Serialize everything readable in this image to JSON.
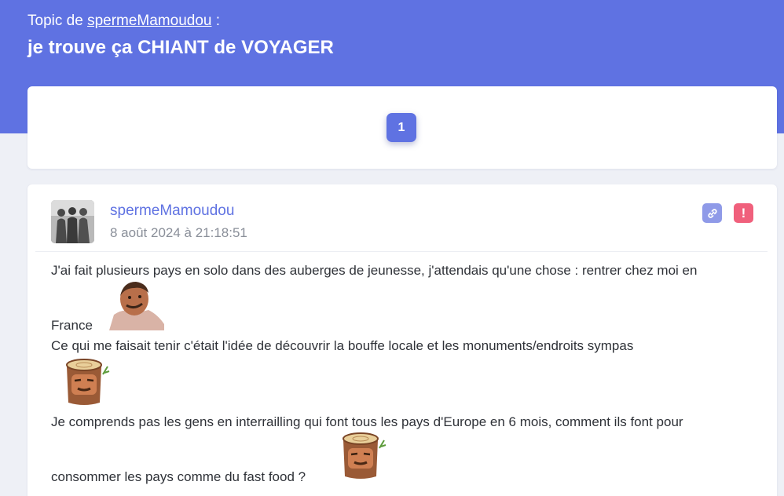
{
  "header": {
    "topic_prefix": "Topic de",
    "topic_author": "spermeMamoudou",
    "topic_suffix": " :",
    "title": "je trouve ça CHIANT de VOYAGER"
  },
  "pagination": {
    "pages": [
      "1"
    ],
    "current": "1"
  },
  "post": {
    "author": "spermeMamoudou",
    "date": "8 août 2024 à 21:18:51",
    "lines": [
      "J'ai fait plusieurs pays en solo dans des auberges de jeunesse, j'attendais qu'une chose : rentrer chez moi en",
      "France",
      "Ce qui me faisait tenir c'était l'idée de découvrir la bouffe locale et les monuments/endroits sympas",
      "Je comprends pas les gens en interrailling qui font tous les pays d'Europe en 6 mois, comment ils font pour",
      "consommer les pays comme du fast food ?"
    ],
    "stickers": [
      "laughing-man-sticker",
      "stump-face-sticker",
      "stump-face-sticker"
    ],
    "actions": {
      "link_icon": "link-icon",
      "report_icon": "exclamation-icon",
      "report_label": "!"
    }
  },
  "colors": {
    "accent": "#5f72e2",
    "report": "#f0607c",
    "link": "#8f9ae8",
    "background": "#eef0f6"
  }
}
